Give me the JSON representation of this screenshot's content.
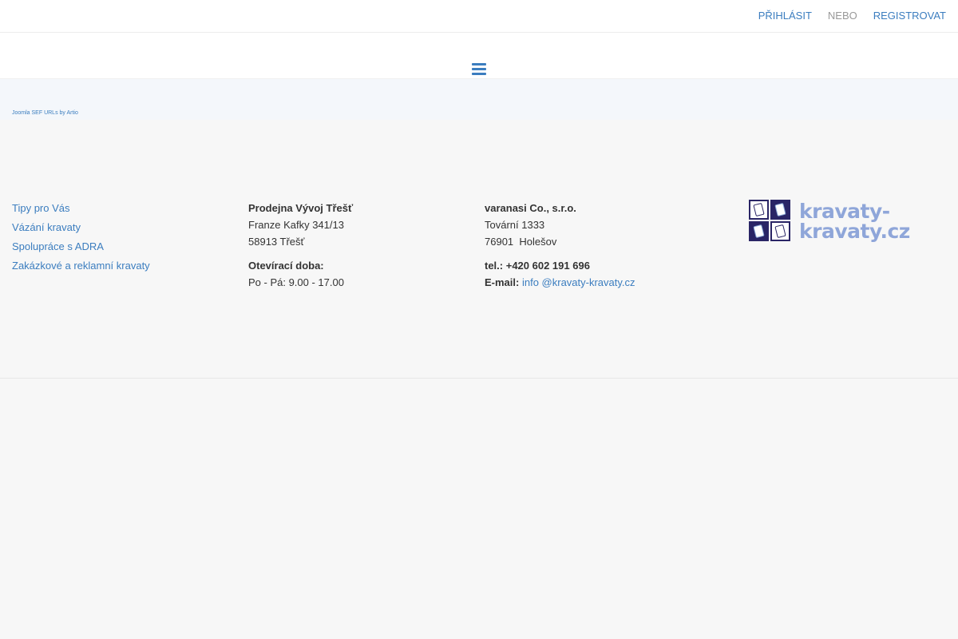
{
  "topbar": {
    "login_label": "PŘIHLÁSIT",
    "or_label": "NEBO",
    "register_label": "REGISTROVAT"
  },
  "navbar": {
    "menu_icon": "hamburger-menu-icon"
  },
  "sef": {
    "link_text": "Joomla SEF URLs by Artio"
  },
  "footer": {
    "links": [
      "Tipy pro Vás",
      "Vázání kravaty",
      "Spolupráce s ADRA",
      "Zakázkové a reklamní kravaty"
    ],
    "shop": {
      "name": "Prodejna Vývoj Třešť",
      "street": "Franze Kafky 341/13",
      "city": "58913 Třešť",
      "hours_label": "Otevírací doba:",
      "hours": "Po - Pá: 9.00 - 17.00"
    },
    "company": {
      "name": "varanasi Co., s.r.o.",
      "street": "Tovární 1333",
      "city": "76901  Holešov",
      "phone_label": "tel.:",
      "phone_value": " +420 602 191 696",
      "email_label": "E-mail:",
      "email_value": "info @kravaty-kravaty.cz"
    },
    "logo": {
      "line1": "kravaty-",
      "line2": "kravaty.cz",
      "color": "#8fa6d9",
      "tile_color": "#2a2566"
    }
  }
}
